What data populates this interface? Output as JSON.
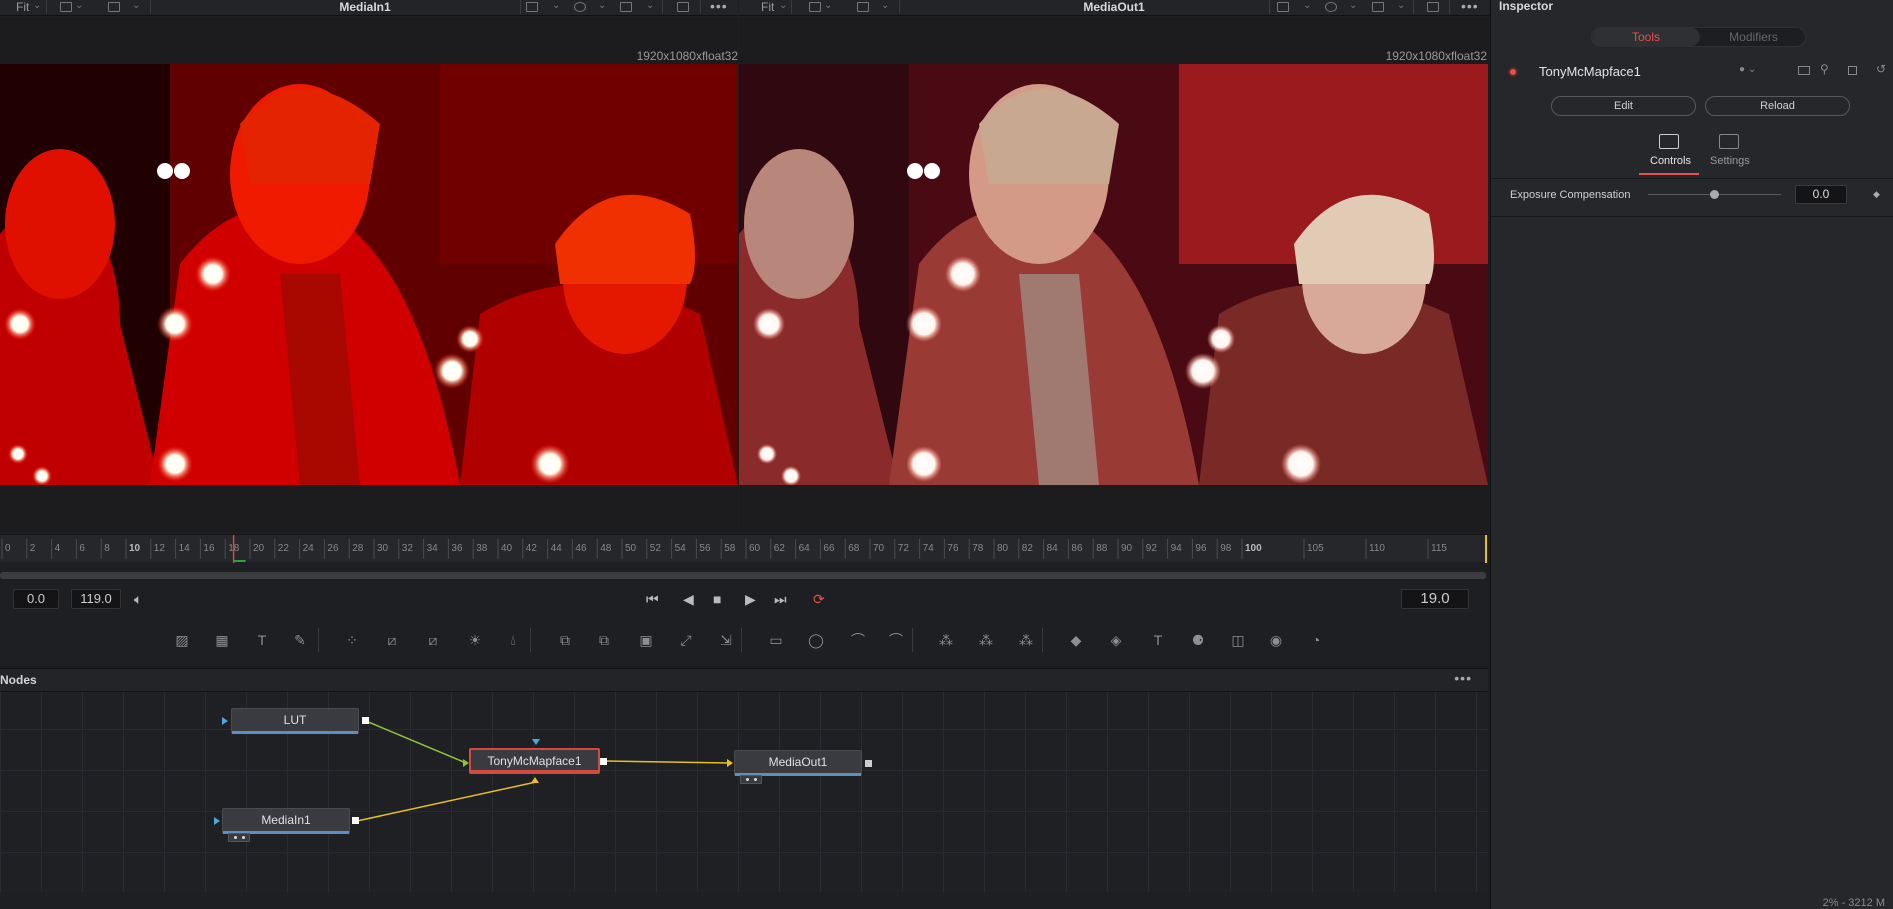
{
  "viewer_left": {
    "fit_label": "Fit",
    "title": "MediaIn1",
    "resolution": "1920x1080xfloat32"
  },
  "viewer_right": {
    "fit_label": "Fit",
    "title": "MediaOut1",
    "resolution": "1920x1080xfloat32"
  },
  "ruler": {
    "ticks": [
      "0",
      "2",
      "4",
      "6",
      "8",
      "10",
      "12",
      "14",
      "16",
      "18",
      "20",
      "22",
      "24",
      "26",
      "28",
      "30",
      "32",
      "34",
      "36",
      "38",
      "40",
      "42",
      "44",
      "46",
      "48",
      "50",
      "52",
      "54",
      "56",
      "58",
      "60",
      "62",
      "64",
      "66",
      "68",
      "70",
      "72",
      "74",
      "76",
      "78",
      "80",
      "82",
      "84",
      "86",
      "88",
      "90",
      "92",
      "94",
      "96",
      "98",
      "100",
      "105",
      "110",
      "115"
    ],
    "bold_ticks": [
      "10",
      "100"
    ],
    "current_frame": 19
  },
  "transport": {
    "start": "0.0",
    "end": "119.0",
    "current": "19.0"
  },
  "toolbar": {
    "icons": [
      "background-icon",
      "image-icon",
      "text-icon",
      "paint-icon",
      "particles-icon",
      "color-corrector-icon",
      "color-curves-icon",
      "brightness-contrast-icon",
      "blur-icon",
      "merge-icon",
      "channel-booleans-icon",
      "matte-control-icon",
      "transform-icon",
      "resize-icon",
      "rectangle-mask-icon",
      "ellipse-mask-icon",
      "polygon-mask-icon",
      "bspline-mask-icon",
      "emitter-icon",
      "particle-render-icon",
      "particle-force-icon",
      "shape3d-icon",
      "merge3d-icon",
      "text3d-icon",
      "camera3d-icon",
      "image-plane-icon",
      "renderer3d-icon",
      "lights-icon"
    ]
  },
  "nodes_panel": {
    "title": "Nodes"
  },
  "nodes": [
    {
      "id": "lut",
      "label": "LUT"
    },
    {
      "id": "tony",
      "label": "TonyMcMapface1"
    },
    {
      "id": "mediaout",
      "label": "MediaOut1"
    },
    {
      "id": "mediain",
      "label": "MediaIn1"
    }
  ],
  "inspector": {
    "title": "Inspector",
    "tabs": [
      "Tools",
      "Modifiers"
    ],
    "active_tab": "Tools",
    "tool_name": "TonyMcMapface1",
    "buttons": {
      "edit": "Edit",
      "reload": "Reload"
    },
    "subtabs": [
      "Controls",
      "Settings"
    ],
    "param": {
      "label": "Exposure Compensation",
      "value": "0.0",
      "slider_fraction": 0.5
    }
  },
  "status": "2% - 3212 M",
  "colors": {
    "accent": "#e8504a",
    "node_bar": "#5e8fc0",
    "link_green": "#8fc23a",
    "link_yellow": "#e8c020"
  }
}
